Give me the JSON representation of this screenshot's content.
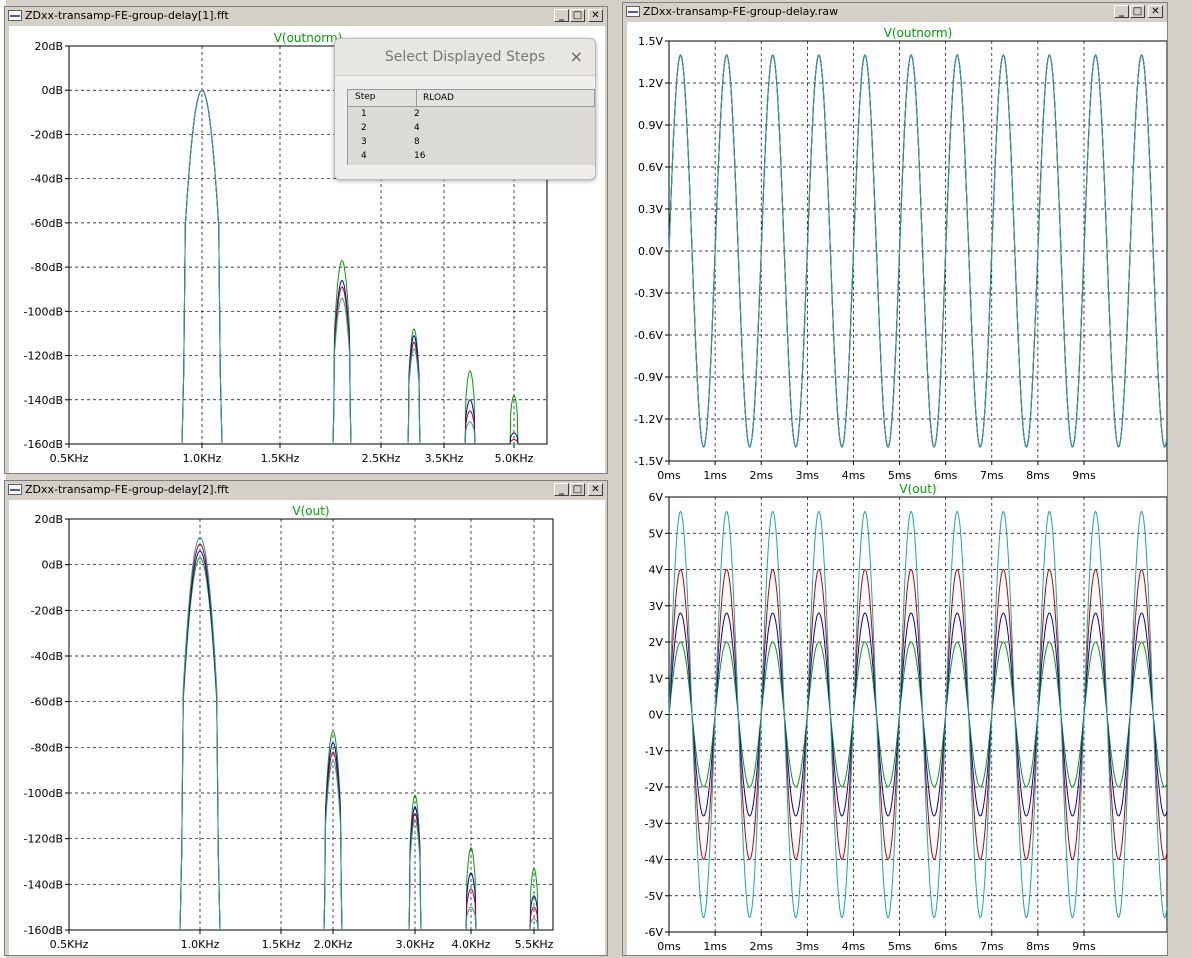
{
  "colors": {
    "grid": "#000000",
    "trace_title": "#00a000",
    "cyan": "#1aa6a6",
    "red": "#c00000",
    "blue": "#0000c0",
    "green": "#00a000"
  },
  "windows": [
    {
      "id": "fft1",
      "title": "ZDxx-transamp-FE-group-delay[1].fft",
      "trace": "V(outnorm)",
      "y_ticks": [
        "20dB",
        "0dB",
        "-20dB",
        "-40dB",
        "-60dB",
        "-80dB",
        "-100dB",
        "-120dB",
        "-140dB",
        "-160dB"
      ],
      "x_ticks": [
        "0.5KHz",
        "1.0KHz",
        "1.5KHz",
        "2.5KHz",
        "3.5KHz",
        "5.0KHz"
      ]
    },
    {
      "id": "fft2",
      "title": "ZDxx-transamp-FE-group-delay[2].fft",
      "trace": "V(out)",
      "y_ticks": [
        "20dB",
        "0dB",
        "-20dB",
        "-40dB",
        "-60dB",
        "-80dB",
        "-100dB",
        "-120dB",
        "-140dB",
        "-160dB"
      ],
      "x_ticks": [
        "0.5KHz",
        "1.0KHz",
        "1.5KHz",
        "2.0KHz",
        "3.0KHz",
        "4.0KHz",
        "5.5KHz"
      ]
    },
    {
      "id": "raw",
      "title": "ZDxx-transamp-FE-group-delay.raw",
      "trace_top": "V(outnorm)",
      "trace_bottom": "V(out)",
      "top_y_ticks": [
        "1.5V",
        "1.2V",
        "0.9V",
        "0.6V",
        "0.3V",
        "0.0V",
        "-0.3V",
        "-0.6V",
        "-0.9V",
        "-1.2V",
        "-1.5V"
      ],
      "bottom_y_ticks": [
        "6V",
        "5V",
        "4V",
        "3V",
        "2V",
        "1V",
        "0V",
        "-1V",
        "-2V",
        "-3V",
        "-4V",
        "-5V",
        "-6V"
      ],
      "x_ticks": [
        "0ms",
        "1ms",
        "2ms",
        "3ms",
        "4ms",
        "5ms",
        "6ms",
        "7ms",
        "8ms",
        "9ms"
      ]
    }
  ],
  "dialog": {
    "title": "Select Displayed Steps",
    "close": "×",
    "col_step": "Step",
    "col_rload": "RLOAD",
    "rows": [
      {
        "step": "1",
        "rload": "2"
      },
      {
        "step": "2",
        "rload": "4"
      },
      {
        "step": "3",
        "rload": "8"
      },
      {
        "step": "4",
        "rload": "16"
      }
    ]
  },
  "chart_data": [
    {
      "type": "line",
      "title": "V(outnorm)",
      "xlabel": "",
      "ylabel": "",
      "ylim": [
        -160,
        20
      ],
      "x_ticks": [
        "0.5KHz",
        "1.0KHz",
        "1.5KHz",
        "2.5KHz",
        "3.5KHz",
        "5.0KHz"
      ],
      "series": [
        {
          "name": "1",
          "peaks_dB": [
            0,
            -94,
            -117,
            -150,
            -160
          ]
        },
        {
          "name": "2",
          "peaks_dB": [
            0,
            -89,
            -114,
            -145,
            -158
          ]
        },
        {
          "name": "3",
          "peaks_dB": [
            0,
            -86,
            -111,
            -140,
            -155
          ]
        },
        {
          "name": "4",
          "peaks_dB": [
            0,
            -77,
            -108,
            -127,
            -138
          ]
        }
      ]
    },
    {
      "type": "line",
      "title": "V(out)",
      "xlabel": "",
      "ylabel": "",
      "ylim": [
        -160,
        20
      ],
      "x_ticks": [
        "0.5KHz",
        "1.0KHz",
        "1.5KHz",
        "2.0KHz",
        "3.0KHz",
        "4.0KHz",
        "5.5KHz"
      ],
      "series": [
        {
          "name": "1",
          "peaks_dB": [
            12,
            -86,
            -112,
            -150,
            -155
          ]
        },
        {
          "name": "2",
          "peaks_dB": [
            9,
            -82,
            -109,
            -142,
            -150
          ]
        },
        {
          "name": "3",
          "peaks_dB": [
            6,
            -78,
            -106,
            -135,
            -145
          ]
        },
        {
          "name": "4",
          "peaks_dB": [
            3,
            -73,
            -101,
            -124,
            -133
          ]
        }
      ]
    },
    {
      "type": "line",
      "title": "V(outnorm)",
      "xlabel": "",
      "ylabel": "",
      "ylim": [
        -1.5,
        1.5
      ],
      "x_range_ms": [
        0,
        10
      ],
      "frequency_kHz": 1,
      "series": [
        {
          "name": "1",
          "amplitude": 1.4
        },
        {
          "name": "2",
          "amplitude": 1.4
        },
        {
          "name": "3",
          "amplitude": 1.4
        },
        {
          "name": "4",
          "amplitude": 1.4
        }
      ]
    },
    {
      "type": "line",
      "title": "V(out)",
      "xlabel": "",
      "ylabel": "",
      "ylim": [
        -6,
        6
      ],
      "x_range_ms": [
        0,
        10
      ],
      "frequency_kHz": 1,
      "series": [
        {
          "name": "1",
          "amplitude": 5.6
        },
        {
          "name": "2",
          "amplitude": 4.0
        },
        {
          "name": "3",
          "amplitude": 2.8
        },
        {
          "name": "4",
          "amplitude": 2.0
        }
      ]
    }
  ]
}
